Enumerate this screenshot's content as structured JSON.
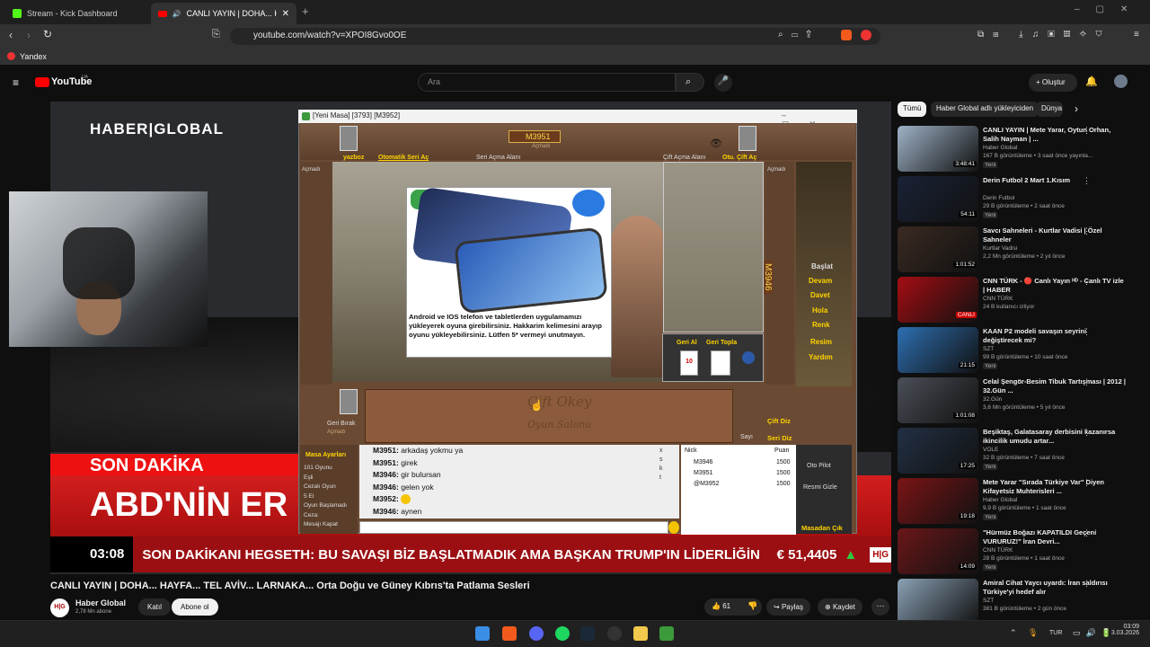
{
  "browser": {
    "tabs": [
      {
        "label": "Stream - Kick Dashboard"
      },
      {
        "label": "CANLI YAYIN | DOHA... HAYFA..."
      }
    ],
    "url": "youtube.com/watch?v=XPOI8Gvo0OE",
    "bookmark": "Yandex"
  },
  "youtube": {
    "logo": "YouTube",
    "logo_region": "UA",
    "search_placeholder": "Ara",
    "create_label": "Oluştur"
  },
  "video": {
    "channel_logo": "HABER|GLOBAL",
    "breaking_label": "SON DAKİKA",
    "headline": "ABD'NİN ER",
    "ticker_time": "03:08",
    "ticker_label": "SON DAKİKA",
    "ticker_text": "NI HEGSETH: BU SAVAŞI BİZ BAŞLATMADIK AMA BAŞKAN TRUMP'IN LİDERLİĞİN",
    "ticker_currency": "€ 51,4405",
    "brand_badge": "H|G",
    "title": "CANLI YAYIN | DOHA... HAYFA... TEL AVİV... LARNAKA... Orta Doğu ve Güney Kıbrıs'ta Patlama Sesleri",
    "channel_name": "Haber Global",
    "subscribers": "2,78 Mn abone",
    "join_label": "Katıl",
    "subscribe_label": "Abone ol",
    "likes": "61",
    "share_label": "Paylaş",
    "save_label": "Kaydet"
  },
  "game": {
    "window_title": "[Yeni Masa] [3793] [M3952]",
    "top_player": "M3951",
    "top_player_state": "Açmadı",
    "auto_series": "Otomatik Seri Aç",
    "yazboz": "yazboz",
    "series_area": "Seri Açma Alanı",
    "pair_area": "Çift Açma Alanı",
    "pair_button": "Otu. Çift Aç",
    "left_state": "Açmadı",
    "right_state": "Açmadı",
    "right_player": "M3946",
    "ad_text": "Android ve IOS telefon ve tabletlerden uygulamamızı yükleyerek oyuna girebilirsiniz. Hakkarim kelimesini arayıp oyunu yükleyebilirsiniz. Lütfen 5* vermeyi unutmayın.",
    "menu": [
      "Başlat",
      "Devam",
      "Davet",
      "Hola",
      "Renk",
      "Resim",
      "Yardım"
    ],
    "take_back": "Geri Al",
    "take_stone": "Geri Topla",
    "tile_number": "10",
    "left_back": "Geri Bırak",
    "left_back_state": "Açmadı",
    "pair_button2": "Çift Diz",
    "count_label": "Sayı",
    "series_button": "Seri Diz",
    "rack_brand": "Çift Okey",
    "rack_sub": "Oyun Salonu",
    "settings_title": "Masa Ayarları",
    "settings": [
      "101 Oyunu",
      "Eşli",
      "Cezalı Oyun",
      "5 El",
      "Oyun Başlamadı",
      "Ceza:",
      "Mesajı Kapat"
    ],
    "chat": [
      {
        "nick": "M3951:",
        "msg": "arkadaş yokmu ya"
      },
      {
        "nick": "M3951:",
        "msg": "girek"
      },
      {
        "nick": "M3946:",
        "msg": "gir bulursan"
      },
      {
        "nick": "M3946:",
        "msg": "gelen yok"
      },
      {
        "nick": "M3952:",
        "msg": ""
      },
      {
        "nick": "M3946:",
        "msg": "aynen"
      }
    ],
    "players_header": [
      "Nick",
      "Puan"
    ],
    "players": [
      {
        "nick": "M3946",
        "score": "1500"
      },
      {
        "nick": "M3951",
        "score": "1500"
      },
      {
        "nick": "@M3952",
        "score": "1500"
      }
    ],
    "autopilot": "Oto Pilot",
    "hide_image": "Resmi Gizle",
    "leave_table": "Masadan Çık",
    "chat_side": [
      "x",
      "s",
      "k",
      "t"
    ]
  },
  "sidebar": {
    "chips": [
      "Tümü",
      "Haber Global adlı yükleyiciden",
      "Dünya H"
    ],
    "videos": [
      {
        "title": "CANLI YAYIN | Mete Yarar, Oytun Orhan, Salih Nayman | ...",
        "channel": "Haber Global",
        "meta": "167 B görüntüleme • 3 saat önce yayınla...",
        "badge": "Yeni",
        "duration": "3:48:41",
        "color": "#9fb3c8"
      },
      {
        "title": "Derin Futbol 2 Mart 1.Kısım",
        "channel": "Derin Futbol",
        "meta": "29 B görüntüleme • 2 saat önce",
        "badge": "Yeni",
        "duration": "54:11",
        "color": "#1a2236"
      },
      {
        "title": "Savcı Sahneleri - Kurtlar Vadisi | Özel Sahneler",
        "channel": "Kurtlar Vadisi",
        "meta": "2,2 Mn görüntüleme • 2 yıl önce",
        "badge": "",
        "duration": "1:01:52",
        "color": "#3a2a22"
      },
      {
        "title": "CNN TÜRK - 🔴 Canlı Yayın ᴴᴰ - Canlı TV izle | HABER",
        "channel": "CNN TÜRK",
        "meta": "24 B kullanıcı izliyor",
        "badge": "",
        "duration": "CANLI",
        "color": "#a40d12"
      },
      {
        "title": "KAAN P2 modeli savaşın seyrini değiştirecek mi?",
        "channel": "SZT",
        "meta": "99 B görüntüleme • 10 saat önce",
        "badge": "Yeni",
        "duration": "21:15",
        "color": "#2d6fb2"
      },
      {
        "title": "Celal Şengör-Besim Tibuk Tartışması | 2012 | 32.Gün ...",
        "channel": "32.Gün",
        "meta": "3,6 Mn görüntüleme • 5 yıl önce",
        "badge": "",
        "duration": "1:01:08",
        "color": "#4a4e57"
      },
      {
        "title": "Beşiktaş, Galatasaray derbisini kazanırsa ikincilik umudu artar...",
        "channel": "VOLE",
        "meta": "32 B görüntüleme • 7 saat önce",
        "badge": "Yeni",
        "duration": "17:25",
        "color": "#223044"
      },
      {
        "title": "Mete Yarar \"Sırada Türkiye Var\" Diyen Kifayetsiz Muhterisleri ...",
        "channel": "Haber Global",
        "meta": "9,9 B görüntüleme • 1 saat önce",
        "badge": "Yeni",
        "duration": "19:18",
        "color": "#7b1416"
      },
      {
        "title": "\"Hürmüz Boğazı KAPATILDI Geçeni VURURUZ!\" İran Devri...",
        "channel": "CNN TÜRK",
        "meta": "28 B görüntüleme • 1 saat önce",
        "badge": "Yeni",
        "duration": "14:09",
        "color": "#6a1719"
      },
      {
        "title": "Amiral Cihat Yaycı uyardı: İran saldırısı Türkiye'yi hedef alır",
        "channel": "SZT",
        "meta": "381 B görüntüleme • 2 gün önce",
        "badge": "",
        "duration": "",
        "color": "#8aa1b5"
      }
    ]
  },
  "taskbar": {
    "lang": "TUR",
    "time": "03:09",
    "date": "3.03.2026"
  }
}
